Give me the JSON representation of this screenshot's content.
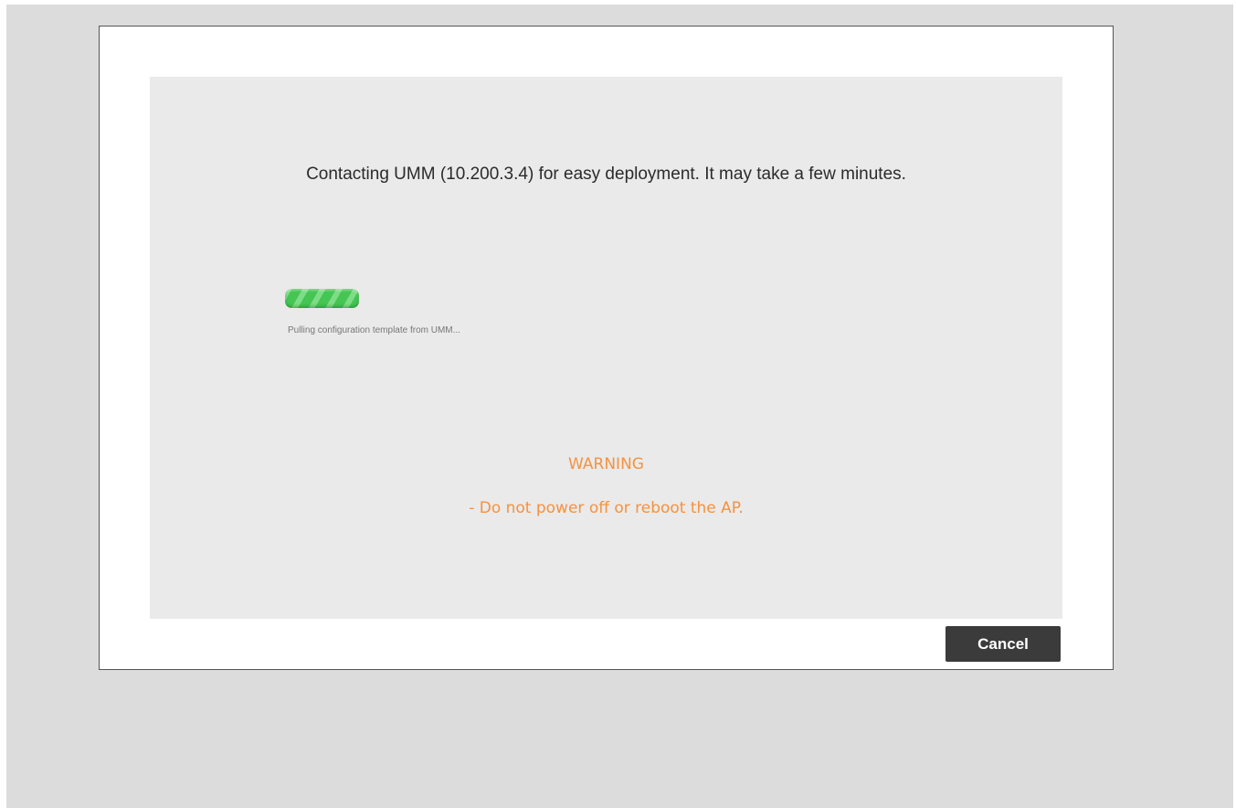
{
  "dialog": {
    "message": "Contacting UMM  (10.200.3.4) for easy deployment. It may take a few minutes.",
    "progress": {
      "status_text": "Pulling configuration template from UMM...",
      "color": "#45c553"
    },
    "warning": {
      "title": "WARNING",
      "text": "- Do not power off or reboot the AP.",
      "color": "#f5923e"
    },
    "cancel_label": "Cancel"
  }
}
